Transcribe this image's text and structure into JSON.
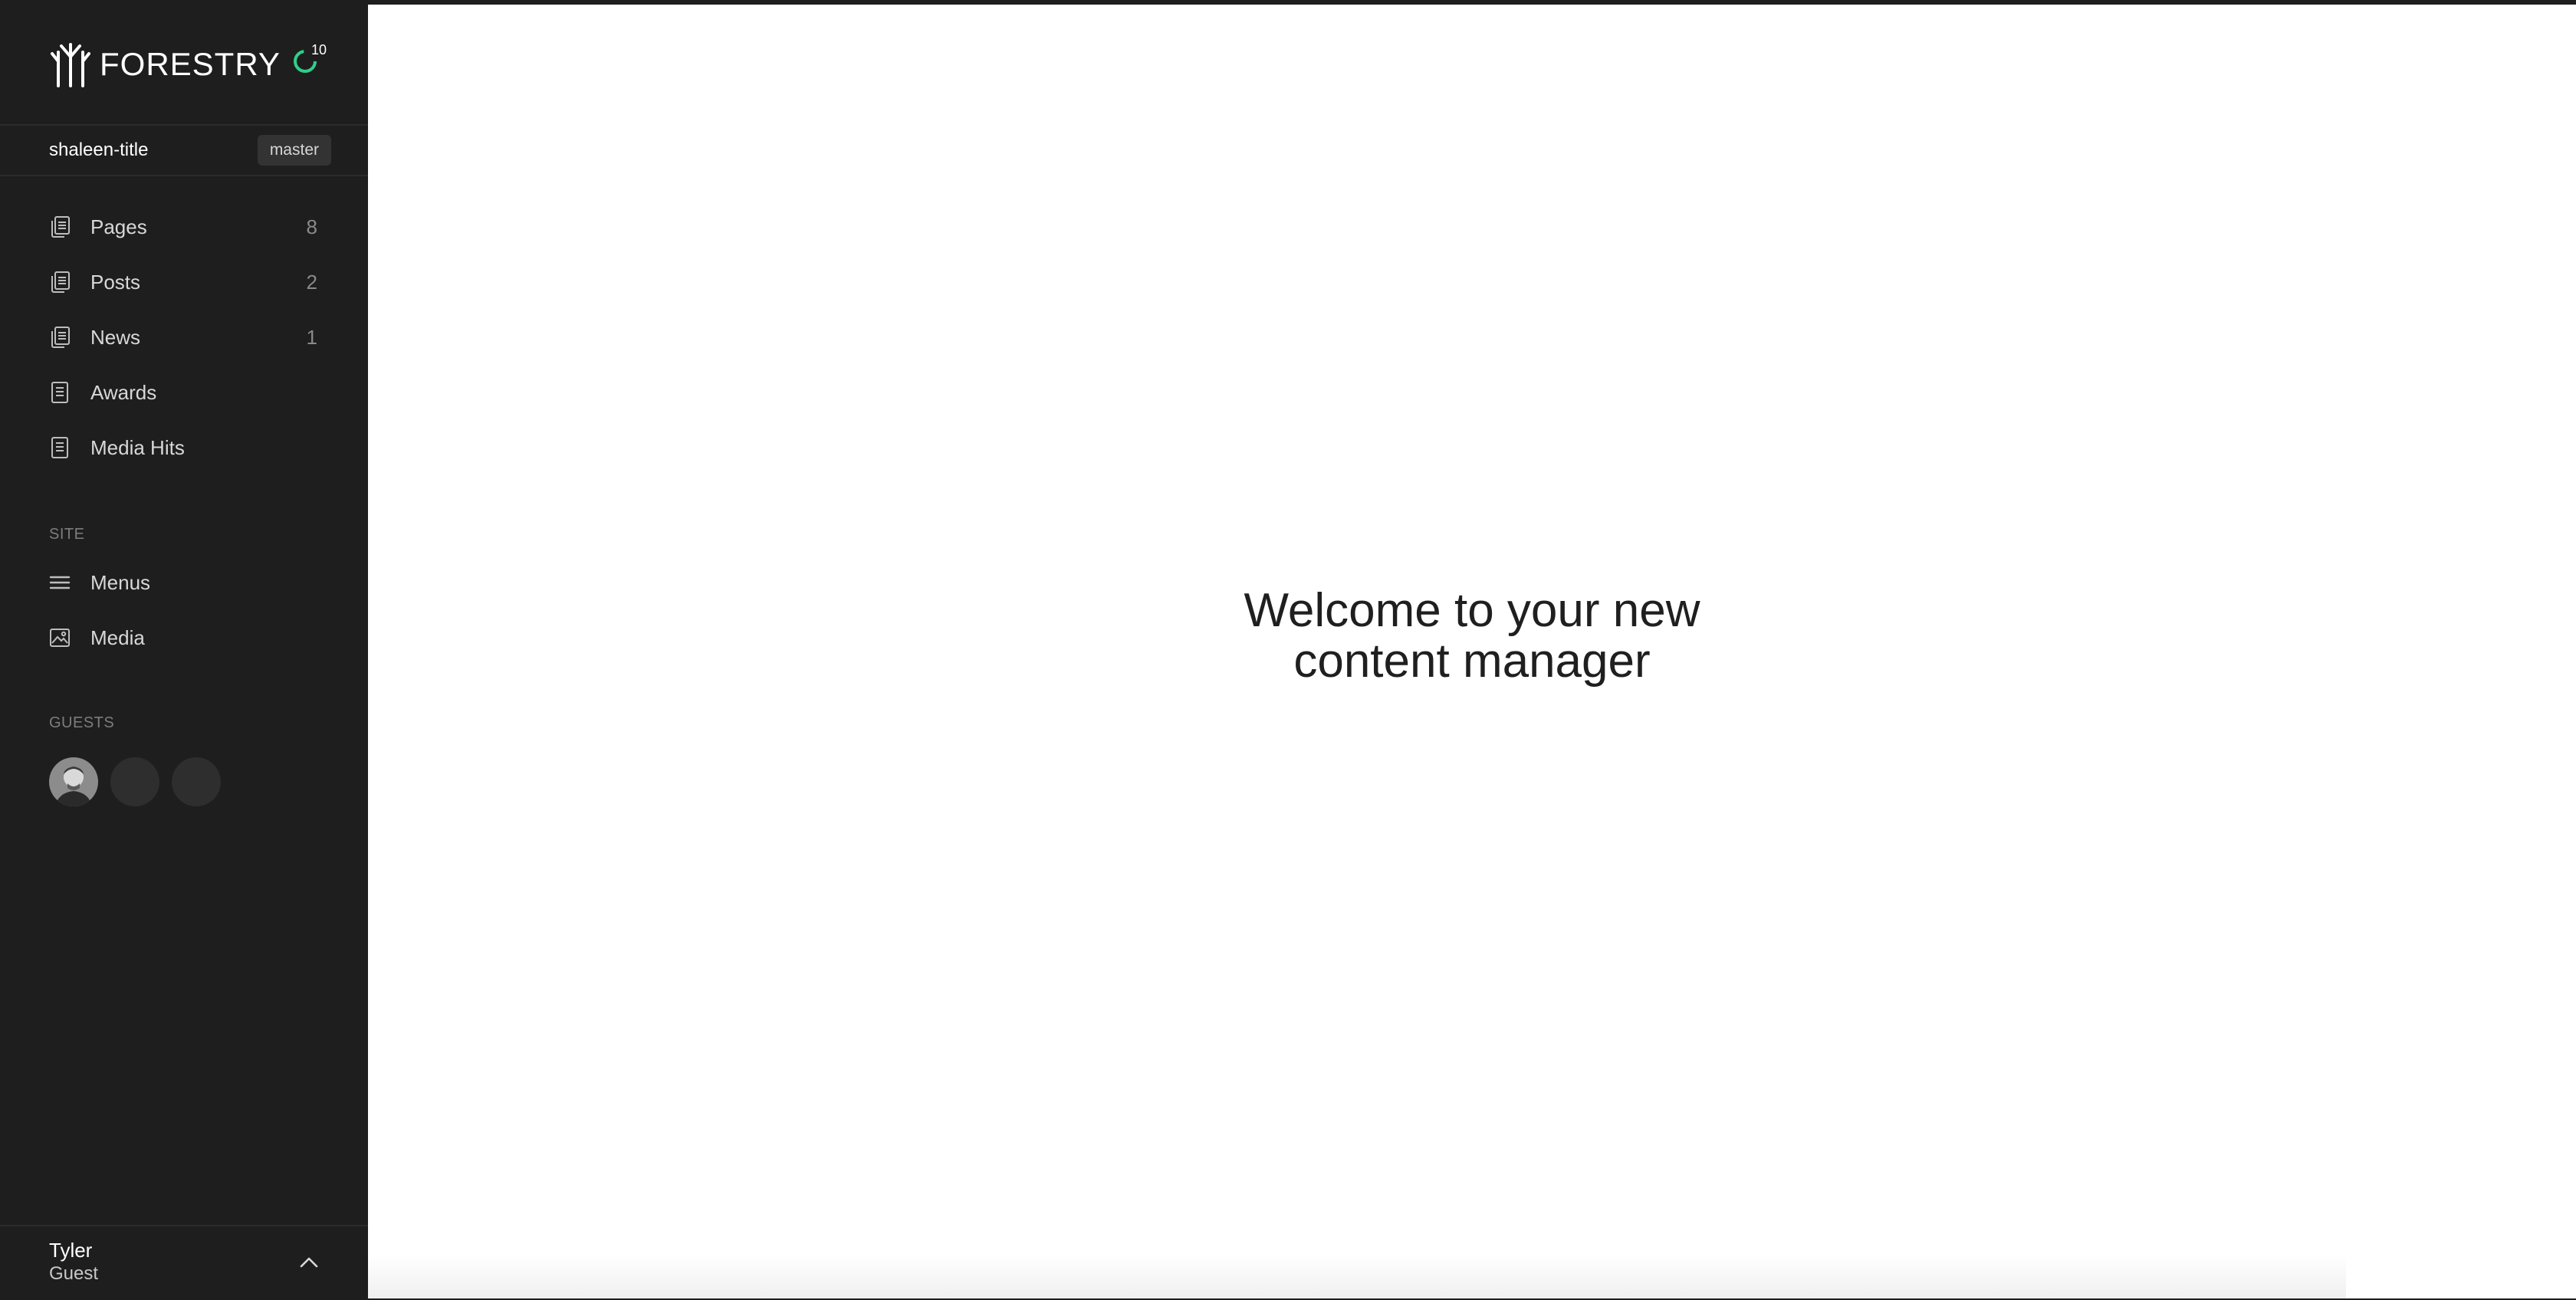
{
  "brand": {
    "name": "FORESTRY",
    "sync_count": "10",
    "accent": "#2fcf8a"
  },
  "repo": {
    "name": "shaleen-title",
    "branch": "master"
  },
  "content_nav": [
    {
      "label": "Pages",
      "count": "8",
      "icon": "documents-icon"
    },
    {
      "label": "Posts",
      "count": "2",
      "icon": "documents-icon"
    },
    {
      "label": "News",
      "count": "1",
      "icon": "documents-icon"
    },
    {
      "label": "Awards",
      "count": "",
      "icon": "document-icon"
    },
    {
      "label": "Media Hits",
      "count": "",
      "icon": "document-icon"
    }
  ],
  "site": {
    "title": "SITE",
    "items": [
      {
        "label": "Menus",
        "icon": "menu-icon"
      },
      {
        "label": "Media",
        "icon": "image-icon"
      }
    ]
  },
  "guests": {
    "title": "GUESTS"
  },
  "user": {
    "name": "Tyler",
    "role": "Guest"
  },
  "main": {
    "welcome_line1": "Welcome to your new",
    "welcome_line2": "content manager"
  }
}
